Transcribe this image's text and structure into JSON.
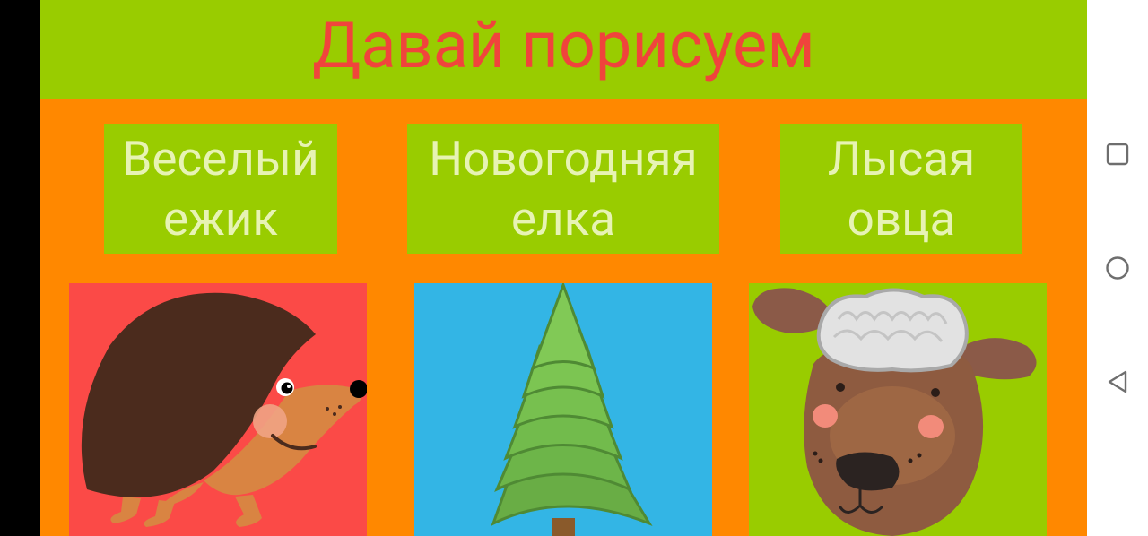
{
  "app": {
    "title": "Давай порисуем",
    "buttons": [
      {
        "line1": "Веселый",
        "line2": "ежик"
      },
      {
        "line1": "Новогодняя",
        "line2": "елка"
      },
      {
        "line1": "Лысая",
        "line2": "овца"
      }
    ],
    "pictures": [
      {
        "icon": "hedgehog-image",
        "bg": "#fb4a47"
      },
      {
        "icon": "christmas-tree-image",
        "bg": "#33b5e5"
      },
      {
        "icon": "sheep-image",
        "bg": "#99cc00"
      }
    ]
  },
  "colors": {
    "header_bg": "#99cc00",
    "title_color": "#f0443c",
    "app_bg": "#ff8800",
    "button_bg": "#99cc00",
    "button_text": "#e7f3b4"
  },
  "navbar": {
    "buttons": [
      "recents-square-icon",
      "home-circle-icon",
      "back-triangle-icon"
    ]
  }
}
